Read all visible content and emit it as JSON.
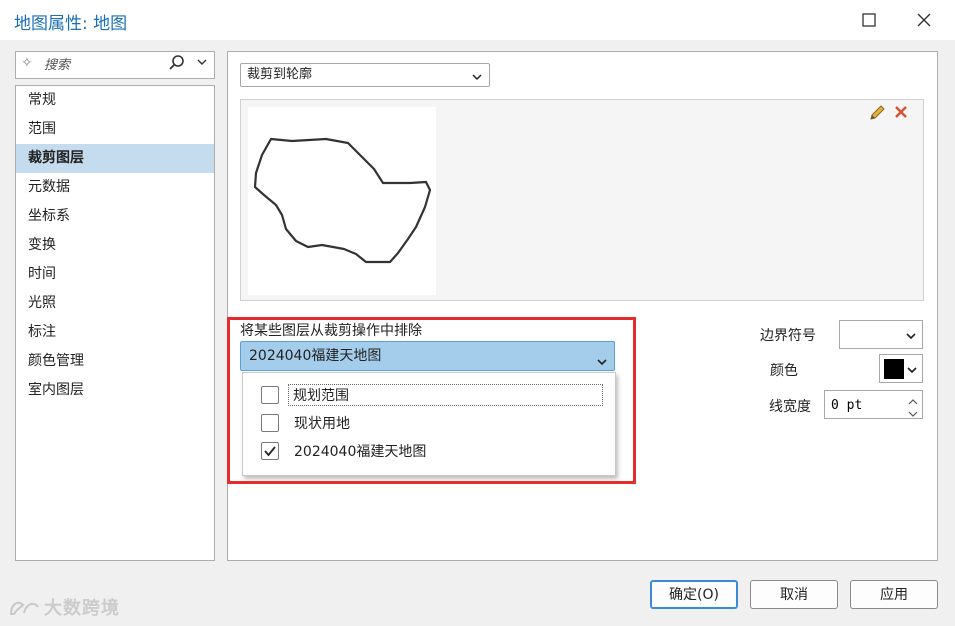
{
  "window": {
    "title": "地图属性: 地图"
  },
  "search": {
    "placeholder": "搜索"
  },
  "sidebar": {
    "items": [
      {
        "label": "常规"
      },
      {
        "label": "范围"
      },
      {
        "label": "裁剪图层",
        "active": true
      },
      {
        "label": "元数据"
      },
      {
        "label": "坐标系"
      },
      {
        "label": "变换"
      },
      {
        "label": "时间"
      },
      {
        "label": "光照"
      },
      {
        "label": "标注"
      },
      {
        "label": "颜色管理"
      },
      {
        "label": "室内图层"
      }
    ]
  },
  "clip": {
    "mode_value": "裁剪到轮廓"
  },
  "exclude": {
    "label": "将某些图层从裁剪操作中排除",
    "selected_value": "2024040福建天地图",
    "options": [
      {
        "label": "规划范围",
        "checked": false
      },
      {
        "label": "现状用地",
        "checked": false
      },
      {
        "label": "2024040福建天地图",
        "checked": true
      }
    ]
  },
  "symbol": {
    "border_label": "边界符号",
    "color_label": "颜色",
    "color_value": "#000000",
    "width_label": "线宽度",
    "width_value": "0 pt"
  },
  "buttons": {
    "ok": "确定(O)",
    "cancel": "取消",
    "apply": "应用"
  },
  "watermark": {
    "text": "大数跨境"
  },
  "colors": {
    "accent": "#1a6fb5",
    "selection": "#c4dcee",
    "highlight_box": "#e52b2b"
  }
}
